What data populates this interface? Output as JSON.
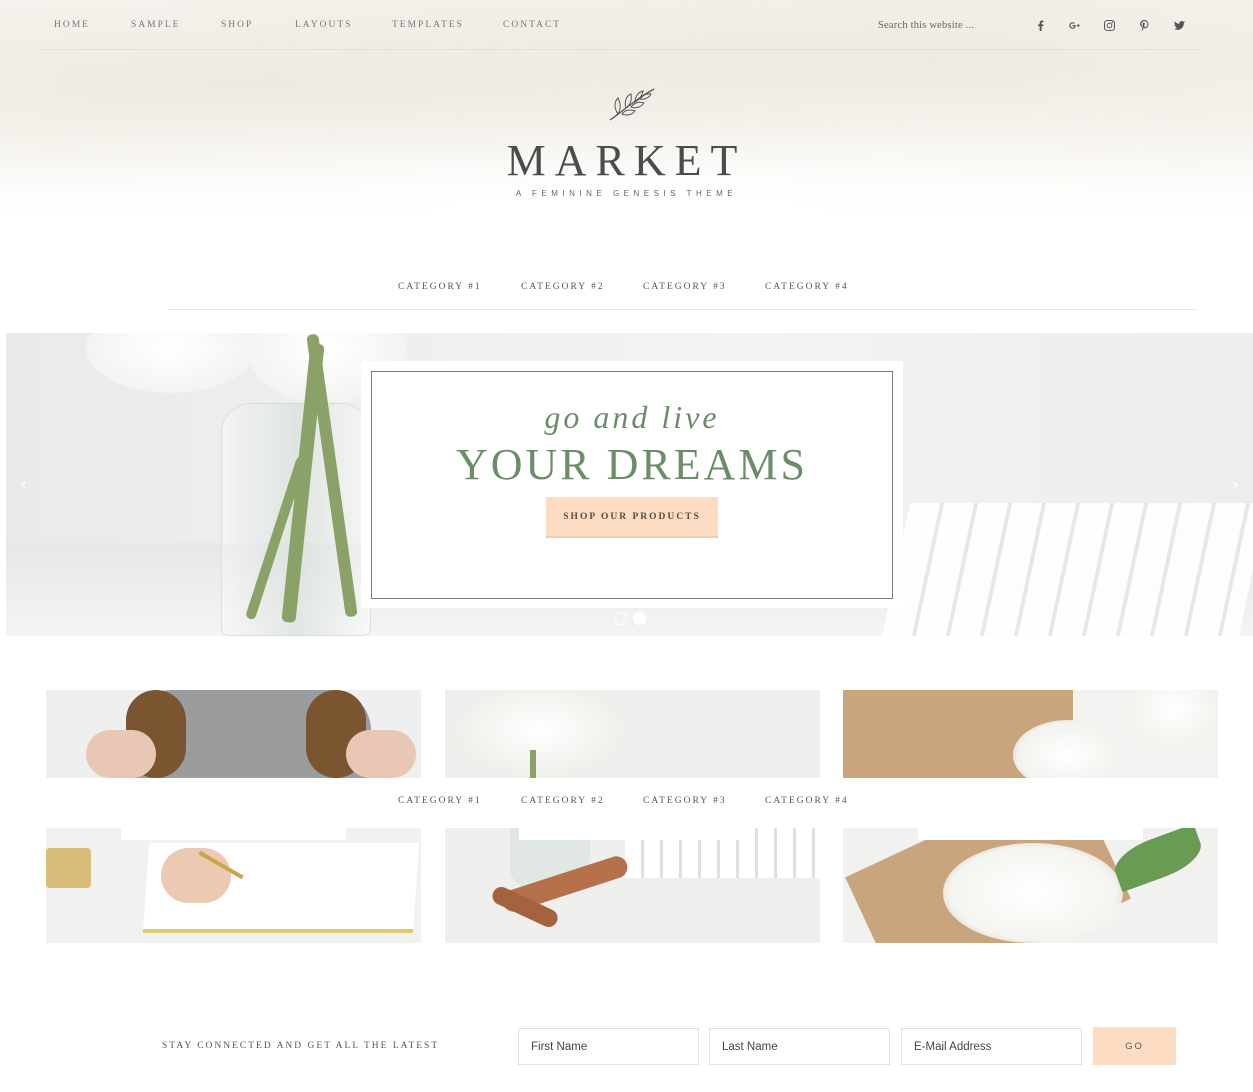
{
  "top_nav": {
    "items": [
      "HOME",
      "SAMPLE",
      "SHOP",
      "LAYOUTS",
      "TEMPLATES",
      "CONTACT"
    ],
    "search_placeholder": "Search this website ...",
    "social_icons": [
      "facebook-icon",
      "google-plus-icon",
      "instagram-icon",
      "pinterest-icon",
      "twitter-icon"
    ]
  },
  "site": {
    "title": "MARKET",
    "tagline": "A FEMININE GENESIS THEME"
  },
  "category_nav": [
    "CATEGORY #1",
    "CATEGORY #2",
    "CATEGORY #3",
    "CATEGORY #4"
  ],
  "hero": {
    "script_text": "go and live",
    "headline": "YOUR DREAMS",
    "button_label": "SHOP OUR PRODUCTS",
    "prev_arrow": "‹",
    "next_arrow": "›",
    "slide_count": 2,
    "active_slide": 2
  },
  "newsletter": {
    "label": "STAY CONNECTED AND GET ALL THE LATEST",
    "first_name_placeholder": "First Name",
    "last_name_placeholder": "Last Name",
    "email_placeholder": "E-Mail Address",
    "button_label": "GO"
  },
  "colors": {
    "accent_green": "#6d8d6a",
    "button_peach": "#fcdcc2",
    "text_gray": "#555555"
  }
}
